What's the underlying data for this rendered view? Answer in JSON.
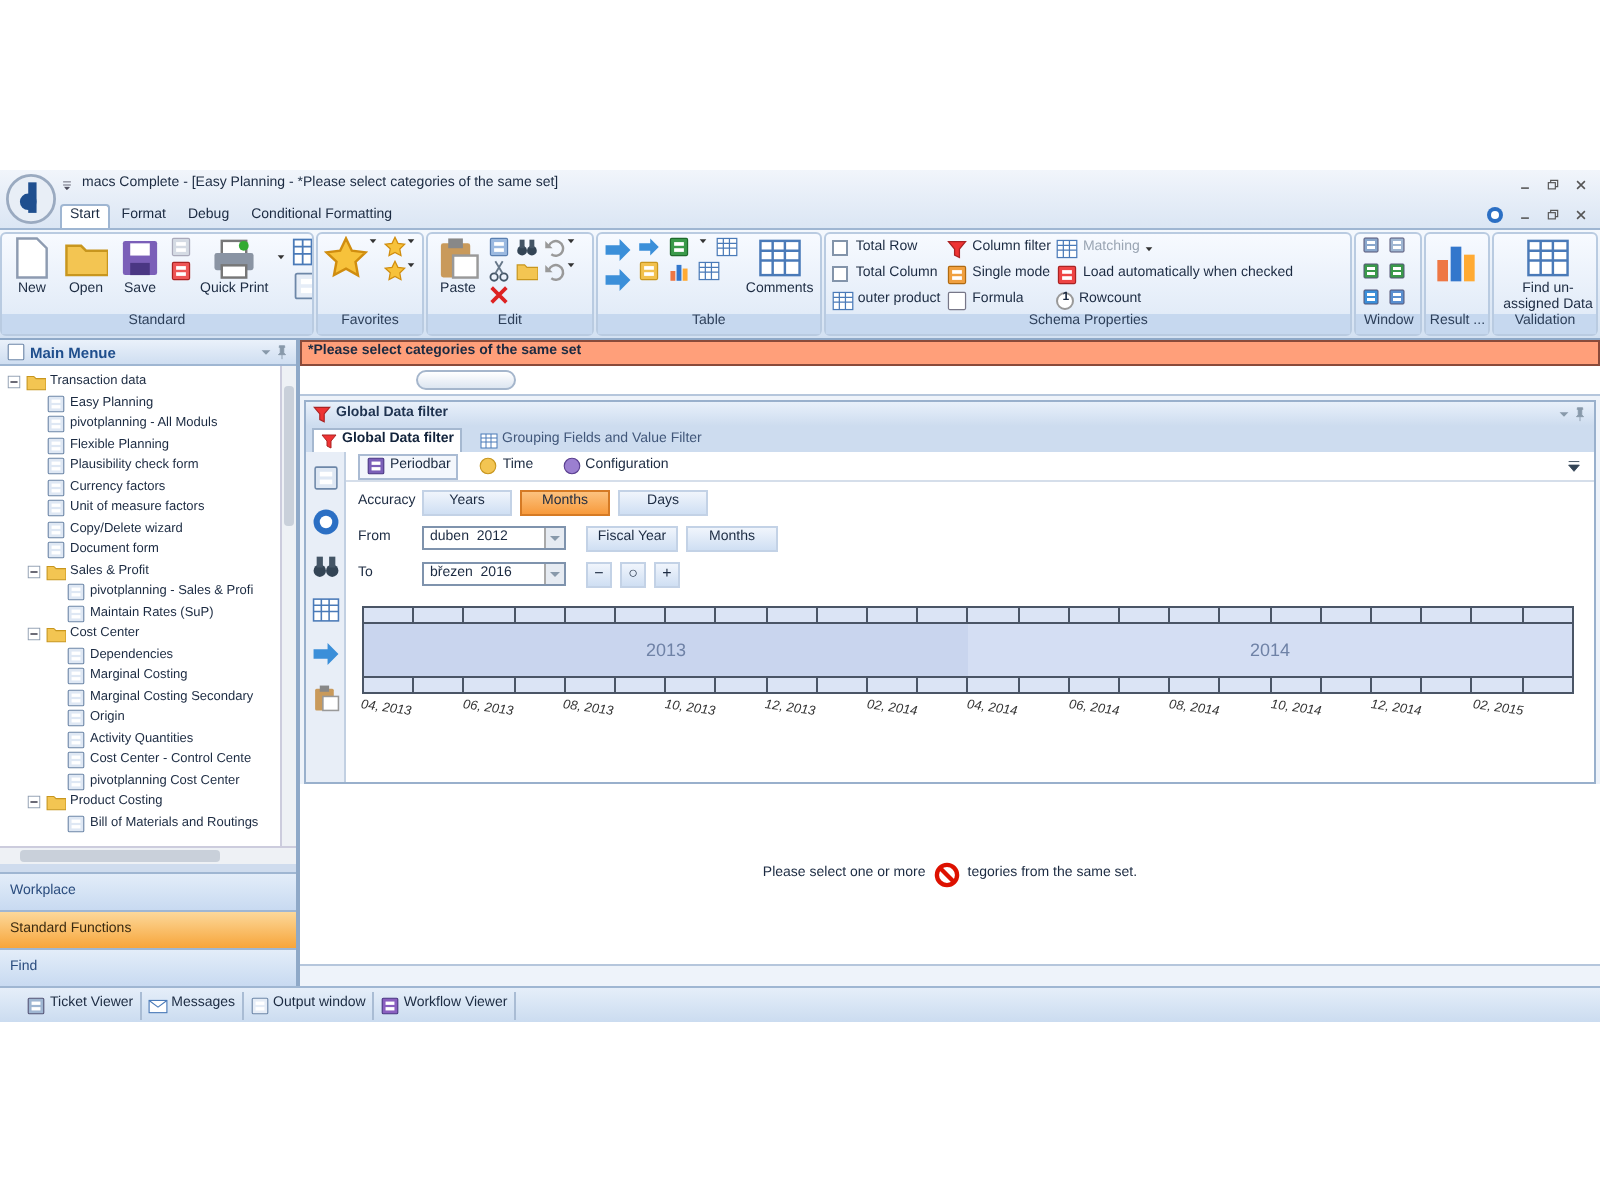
{
  "window": {
    "title": "macs Complete - [Easy Planning - *Please select categories of the same set]"
  },
  "ribbon_tabs": [
    {
      "label": "Start",
      "selected": true
    },
    {
      "label": "Format",
      "selected": false
    },
    {
      "label": "Debug",
      "selected": false
    },
    {
      "label": "Conditional Formatting",
      "selected": false
    }
  ],
  "ribbon": {
    "standard": {
      "label": "Standard",
      "new": "New",
      "open": "Open",
      "save": "Save",
      "quick_print": "Quick Print"
    },
    "favorites": {
      "label": "Favorites"
    },
    "edit": {
      "label": "Edit",
      "paste": "Paste"
    },
    "table": {
      "label": "Table",
      "comments": "Comments"
    },
    "schema": {
      "label": "Schema Properties",
      "total_row": {
        "label": "Total Row",
        "checked": false
      },
      "total_column": {
        "label": "Total Column",
        "checked": false
      },
      "outer_product": "outer product",
      "column_filter": "Column filter",
      "single_mode": "Single mode",
      "formula": "Formula",
      "matching": {
        "label": "Matching",
        "disabled": true
      },
      "load_auto": "Load automatically when checked",
      "rowcount_icon": "1",
      "rowcount": "Rowcount"
    },
    "window_group": {
      "label": "Window"
    },
    "result": {
      "label": "Result ..."
    },
    "validation": {
      "label": "Validation",
      "find": "Find un-assigned Data"
    }
  },
  "main_menu": {
    "title": "Main Menue",
    "tree": [
      {
        "label": "Transaction data",
        "kind": "folder",
        "expanded": true,
        "children": [
          {
            "label": "Easy Planning",
            "kind": "form"
          },
          {
            "label": "pivotplanning - All Moduls",
            "kind": "form"
          },
          {
            "label": "Flexible Planning",
            "kind": "form"
          },
          {
            "label": "Plausibility check form",
            "kind": "form"
          },
          {
            "label": "Currency factors",
            "kind": "form"
          },
          {
            "label": "Unit of measure factors",
            "kind": "form"
          },
          {
            "label": "Copy/Delete wizard",
            "kind": "form"
          },
          {
            "label": "Document form",
            "kind": "form"
          },
          {
            "label": "Sales & Profit",
            "kind": "folder",
            "expanded": true,
            "children": [
              {
                "label": "pivotplanning - Sales & Profi",
                "kind": "form"
              },
              {
                "label": "Maintain Rates (SuP)",
                "kind": "form"
              }
            ]
          },
          {
            "label": "Cost Center",
            "kind": "folder",
            "expanded": true,
            "children": [
              {
                "label": "Dependencies",
                "kind": "form"
              },
              {
                "label": "Marginal Costing",
                "kind": "form"
              },
              {
                "label": "Marginal Costing Secondary",
                "kind": "form"
              },
              {
                "label": "Origin",
                "kind": "form"
              },
              {
                "label": "Activity Quantities",
                "kind": "form"
              },
              {
                "label": "Cost Center - Control Cente",
                "kind": "form"
              },
              {
                "label": "pivotplanning Cost Center",
                "kind": "form"
              }
            ]
          },
          {
            "label": "Product Costing",
            "kind": "folder",
            "expanded": true,
            "children": [
              {
                "label": "Bill of Materials and Routings",
                "kind": "form"
              }
            ]
          }
        ]
      }
    ]
  },
  "nav_buttons": [
    {
      "label": "Workplace",
      "selected": false
    },
    {
      "label": "Standard Functions",
      "selected": true
    },
    {
      "label": "Find",
      "selected": false
    }
  ],
  "warning": "*Please select categories of the same set",
  "filter_panel": {
    "title": "Global Data filter",
    "tabs": [
      {
        "label": "Global Data filter",
        "selected": true
      },
      {
        "label": "Grouping Fields and Value Filter",
        "selected": false
      }
    ],
    "subtabs": [
      {
        "label": "Periodbar",
        "selected": true
      },
      {
        "label": "Time",
        "selected": false
      },
      {
        "label": "Configuration",
        "selected": false
      }
    ],
    "accuracy": {
      "label": "Accuracy",
      "options": [
        {
          "label": "Years",
          "selected": false
        },
        {
          "label": "Months",
          "selected": true
        },
        {
          "label": "Days",
          "selected": false
        }
      ]
    },
    "from": {
      "label": "From",
      "value": "duben  2012",
      "buttons": [
        "Fiscal Year",
        "Months"
      ]
    },
    "to": {
      "label": "To",
      "value": "březen  2016",
      "buttons": [
        "−",
        "○",
        "+"
      ]
    },
    "periodbar": {
      "years": [
        "2013",
        "2014"
      ],
      "months": [
        "04, 2013",
        "06, 2013",
        "08, 2013",
        "10, 2013",
        "12, 2013",
        "02, 2014",
        "04, 2014",
        "06, 2014",
        "08, 2014",
        "10, 2014",
        "12, 2014",
        "02, 2015"
      ]
    }
  },
  "message": {
    "before": "Please select one or more",
    "after": "tegories from the same set."
  },
  "bottom_tabs": [
    "Ticket Viewer",
    "Messages",
    "Output window",
    "Workflow Viewer"
  ]
}
